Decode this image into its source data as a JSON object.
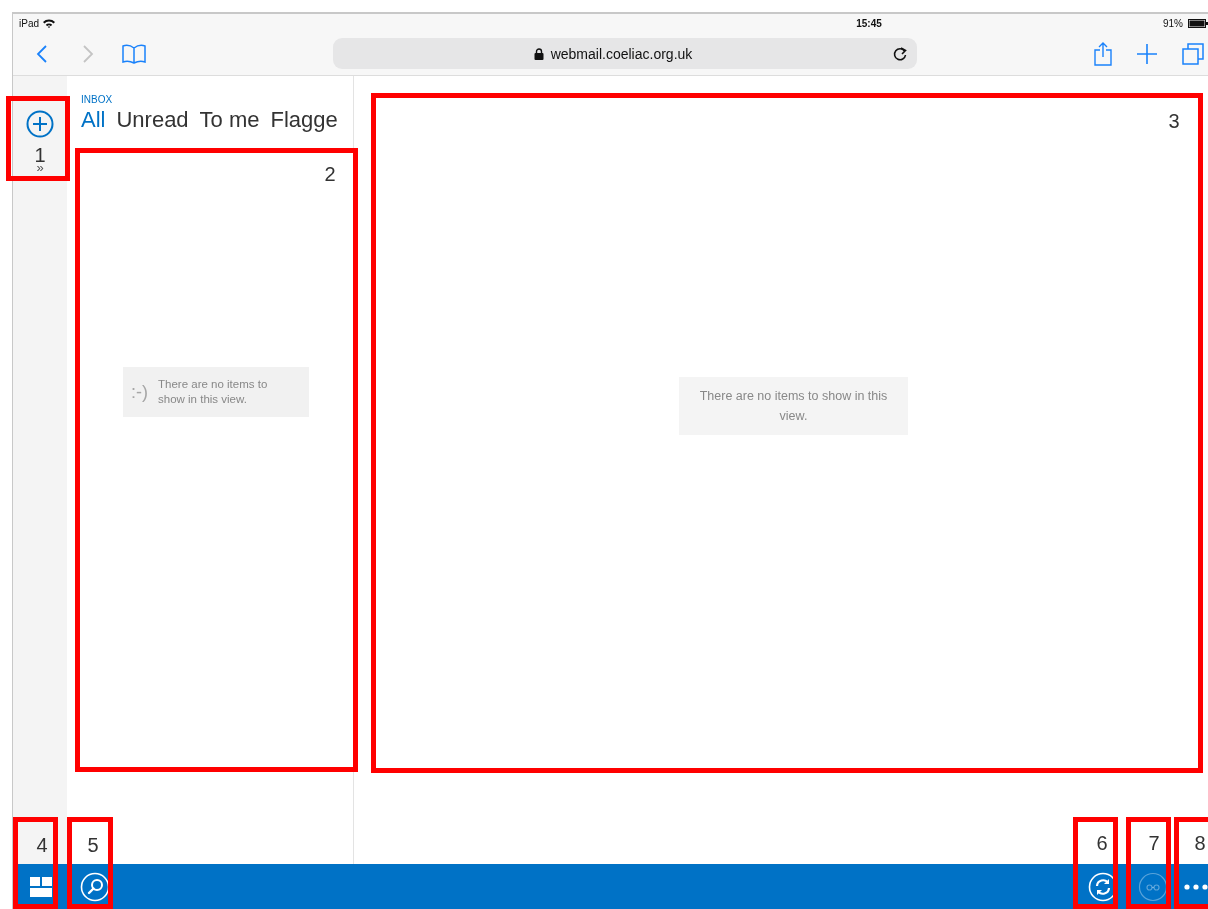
{
  "status_bar": {
    "device": "iPad",
    "time": "15:45",
    "battery": "91%"
  },
  "browser": {
    "url": "webmail.coeliac.org.uk",
    "nav": [
      {
        "kind": "back",
        "disabled": false
      },
      {
        "kind": "forward",
        "disabled": true
      }
    ]
  },
  "rail": {
    "expand": "»"
  },
  "folder": "INBOX",
  "filters": [
    {
      "label": "All",
      "selected": true
    },
    {
      "label": "Unread",
      "selected": false
    },
    {
      "label": "To me",
      "selected": false
    },
    {
      "label": "Flagge",
      "selected": false
    }
  ],
  "list_empty": {
    "face": ":-)",
    "message": "There are no items to show in this view."
  },
  "reading_empty": {
    "message": "There are no items to show in this view."
  },
  "toolbar": [
    {
      "kind": "tiles",
      "disabled": false
    },
    {
      "kind": "search",
      "disabled": false
    },
    {
      "kind": "sync",
      "disabled": false
    },
    {
      "kind": "glasses",
      "disabled": true
    },
    {
      "kind": "more",
      "disabled": false
    }
  ],
  "annotations": [
    {
      "label": "1"
    },
    {
      "label": "2"
    },
    {
      "label": "3"
    },
    {
      "label": "4"
    },
    {
      "label": "5"
    },
    {
      "label": "6"
    },
    {
      "label": "7"
    },
    {
      "label": "8"
    }
  ]
}
